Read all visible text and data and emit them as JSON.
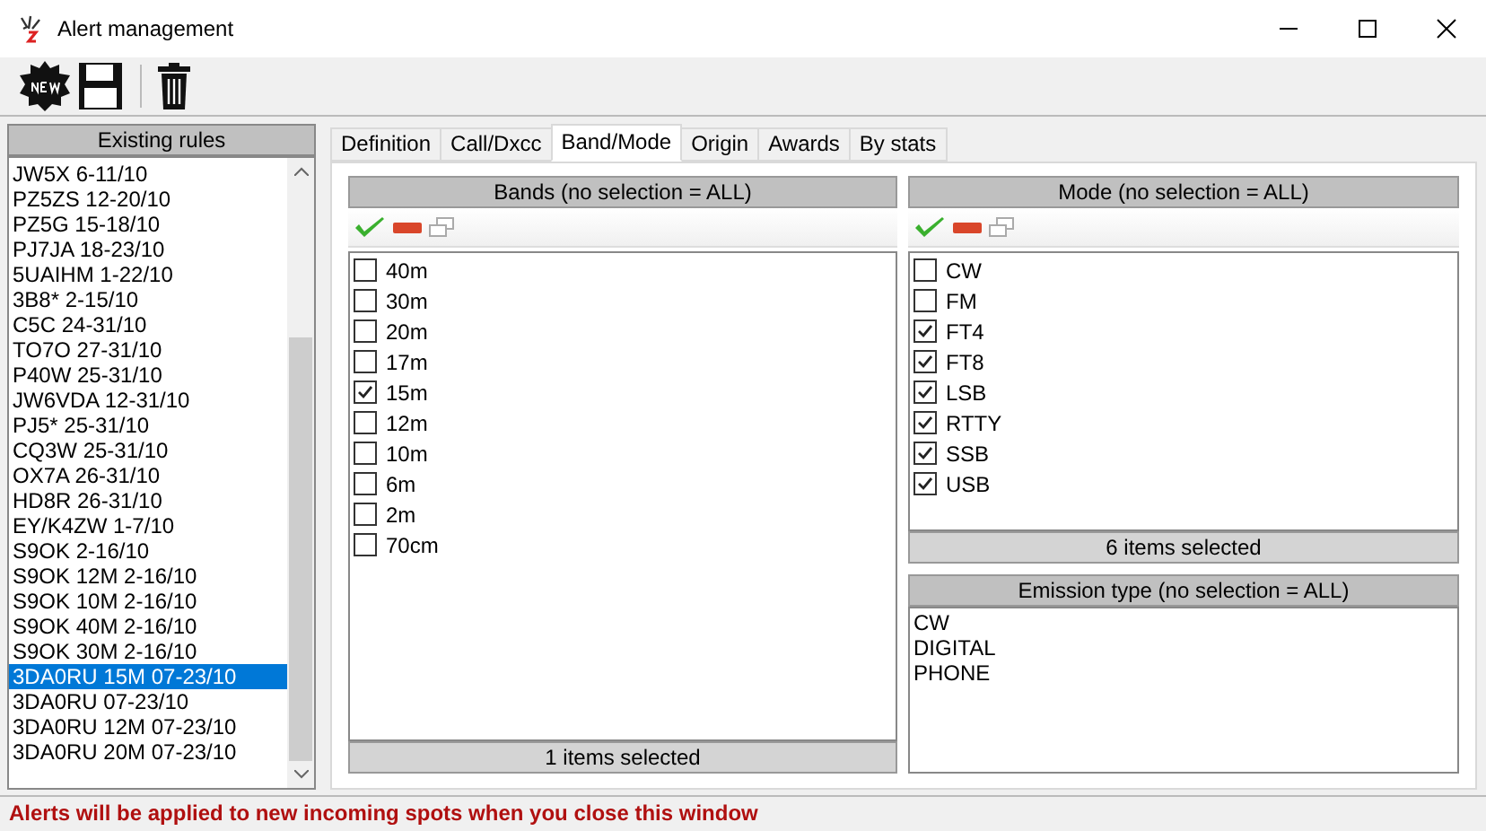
{
  "window": {
    "title": "Alert management"
  },
  "rules": {
    "header": "Existing rules",
    "items": [
      {
        "label": "JW5X 6-11/10",
        "selected": false
      },
      {
        "label": "PZ5ZS 12-20/10",
        "selected": false
      },
      {
        "label": "PZ5G 15-18/10",
        "selected": false
      },
      {
        "label": "PJ7JA 18-23/10",
        "selected": false
      },
      {
        "label": "5UAIHM 1-22/10",
        "selected": false
      },
      {
        "label": "3B8* 2-15/10",
        "selected": false
      },
      {
        "label": "C5C 24-31/10",
        "selected": false
      },
      {
        "label": "TO7O 27-31/10",
        "selected": false
      },
      {
        "label": "P40W 25-31/10",
        "selected": false
      },
      {
        "label": "JW6VDA 12-31/10",
        "selected": false
      },
      {
        "label": "PJ5* 25-31/10",
        "selected": false
      },
      {
        "label": "CQ3W 25-31/10",
        "selected": false
      },
      {
        "label": "OX7A 26-31/10",
        "selected": false
      },
      {
        "label": "HD8R 26-31/10",
        "selected": false
      },
      {
        "label": "EY/K4ZW 1-7/10",
        "selected": false
      },
      {
        "label": "S9OK 2-16/10",
        "selected": false
      },
      {
        "label": "S9OK 12M 2-16/10",
        "selected": false
      },
      {
        "label": "S9OK 10M 2-16/10",
        "selected": false
      },
      {
        "label": "S9OK 40M 2-16/10",
        "selected": false
      },
      {
        "label": "S9OK 30M 2-16/10",
        "selected": false
      },
      {
        "label": "3DA0RU 15M 07-23/10",
        "selected": true
      },
      {
        "label": "3DA0RU 07-23/10",
        "selected": false
      },
      {
        "label": "3DA0RU 12M 07-23/10",
        "selected": false
      },
      {
        "label": "3DA0RU 20M 07-23/10",
        "selected": false
      }
    ]
  },
  "tabs": [
    {
      "label": "Definition",
      "selected": false
    },
    {
      "label": "Call/Dxcc",
      "selected": false
    },
    {
      "label": "Band/Mode",
      "selected": true
    },
    {
      "label": "Origin",
      "selected": false
    },
    {
      "label": "Awards",
      "selected": false
    },
    {
      "label": "By stats",
      "selected": false
    }
  ],
  "bands": {
    "header": "Bands (no selection = ALL)",
    "items": [
      {
        "label": "40m",
        "checked": false
      },
      {
        "label": "30m",
        "checked": false
      },
      {
        "label": "20m",
        "checked": false
      },
      {
        "label": "17m",
        "checked": false
      },
      {
        "label": "15m",
        "checked": true
      },
      {
        "label": "12m",
        "checked": false
      },
      {
        "label": "10m",
        "checked": false
      },
      {
        "label": "6m",
        "checked": false
      },
      {
        "label": "2m",
        "checked": false
      },
      {
        "label": "70cm",
        "checked": false
      }
    ],
    "footer": "1 items selected"
  },
  "modes": {
    "header": "Mode (no selection = ALL)",
    "items": [
      {
        "label": "CW",
        "checked": false
      },
      {
        "label": "FM",
        "checked": false
      },
      {
        "label": "FT4",
        "checked": true
      },
      {
        "label": "FT8",
        "checked": true
      },
      {
        "label": "LSB",
        "checked": true
      },
      {
        "label": "RTTY",
        "checked": true
      },
      {
        "label": "SSB",
        "checked": true
      },
      {
        "label": "USB",
        "checked": true
      }
    ],
    "footer": "6 items selected"
  },
  "emission": {
    "header": "Emission type (no selection = ALL)",
    "items": [
      "CW",
      "DIGITAL",
      "PHONE"
    ]
  },
  "status_bar": "Alerts will be applied to new incoming spots when you close this window"
}
